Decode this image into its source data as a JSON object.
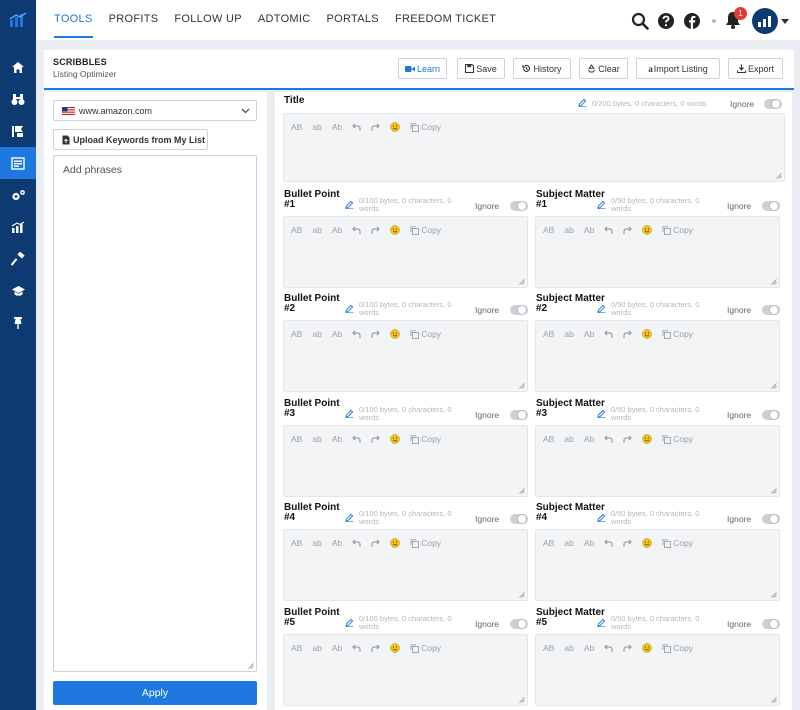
{
  "nav": {
    "items": [
      "TOOLS",
      "PROFITS",
      "FOLLOW UP",
      "ADTOMIC",
      "PORTALS",
      "FREEDOM TICKET"
    ],
    "active": "TOOLS"
  },
  "topbar": {
    "icons": [
      "search-icon",
      "help-icon",
      "facebook-icon",
      "bell-icon",
      "avatar-grid-icon",
      "caret-down-icon"
    ],
    "notification_count": "1"
  },
  "rail": {
    "items": [
      "home-icon",
      "binoculars-icon",
      "keyword-icon",
      "listing-icon",
      "settings-icon",
      "analytics-icon",
      "hammer-icon",
      "graduation-icon",
      "pin-icon"
    ],
    "active": "listing-icon"
  },
  "header": {
    "title": "SCRIBBLES",
    "subtitle": "Listing Optimizer",
    "buttons": {
      "learn": "Learn",
      "save": "Save",
      "history": "History",
      "clear": "Clear",
      "import": "Import Listing",
      "export": "Export"
    }
  },
  "left": {
    "marketplace": "www.amazon.com",
    "upload_label": "Upload Keywords from My List",
    "phrases_placeholder": "Add phrases",
    "apply_label": "Apply"
  },
  "fields": {
    "title": {
      "label": "Title",
      "stats": "0/200 bytes, 0 characters, 0 words",
      "ignore": "Ignore"
    },
    "bullets": [
      {
        "label": "Bullet Point\n#1",
        "stats": "0/100 bytes, 0 characters, 0 words",
        "ignore": "Ignore"
      },
      {
        "label": "Bullet Point\n#2",
        "stats": "0/100 bytes, 0 characters, 0 words",
        "ignore": "Ignore"
      },
      {
        "label": "Bullet Point\n#3",
        "stats": "0/100 bytes, 0 characters, 0 words",
        "ignore": "Ignore"
      },
      {
        "label": "Bullet Point\n#4",
        "stats": "0/100 bytes, 0 characters, 0 words",
        "ignore": "Ignore"
      },
      {
        "label": "Bullet Point\n#5",
        "stats": "0/100 bytes, 0 characters, 0 words",
        "ignore": "Ignore"
      }
    ],
    "subjects": [
      {
        "label": "Subject Matter\n#1",
        "stats": "0/50 bytes, 0 characters, 0 words",
        "ignore": "Ignore"
      },
      {
        "label": "Subject Matter\n#2",
        "stats": "0/50 bytes, 0 characters, 0 words",
        "ignore": "Ignore"
      },
      {
        "label": "Subject Matter\n#3",
        "stats": "0/50 bytes, 0 characters, 0 words",
        "ignore": "Ignore"
      },
      {
        "label": "Subject Matter\n#4",
        "stats": "0/50 bytes, 0 characters, 0 words",
        "ignore": "Ignore"
      },
      {
        "label": "Subject Matter\n#5",
        "stats": "0/50 bytes, 0 characters, 0 words",
        "ignore": "Ignore"
      }
    ]
  },
  "editor_tools": {
    "upper": "AB",
    "lower": "ab",
    "title": "Ab",
    "copy": "Copy"
  },
  "colors": {
    "accent": "#1e78e0",
    "rail": "#0e3a72",
    "badge": "#e53935"
  }
}
